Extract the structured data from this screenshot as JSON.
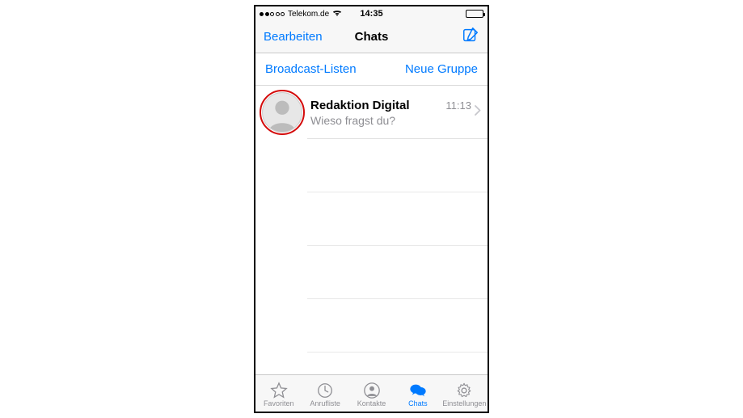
{
  "statusbar": {
    "carrier": "Telekom.de",
    "time": "14:35",
    "signal_filled": 2,
    "signal_total": 5
  },
  "nav": {
    "edit": "Bearbeiten",
    "title": "Chats"
  },
  "subheader": {
    "broadcast": "Broadcast-Listen",
    "newgroup": "Neue Gruppe"
  },
  "chats": [
    {
      "name": "Redaktion Digital",
      "time": "11:13",
      "preview": "Wieso fragst du?",
      "highlighted": true
    }
  ],
  "tabs": {
    "favorites": "Favoriten",
    "recents": "Anrufliste",
    "contacts": "Kontakte",
    "chats": "Chats",
    "settings": "Einstellungen",
    "active": "chats"
  }
}
